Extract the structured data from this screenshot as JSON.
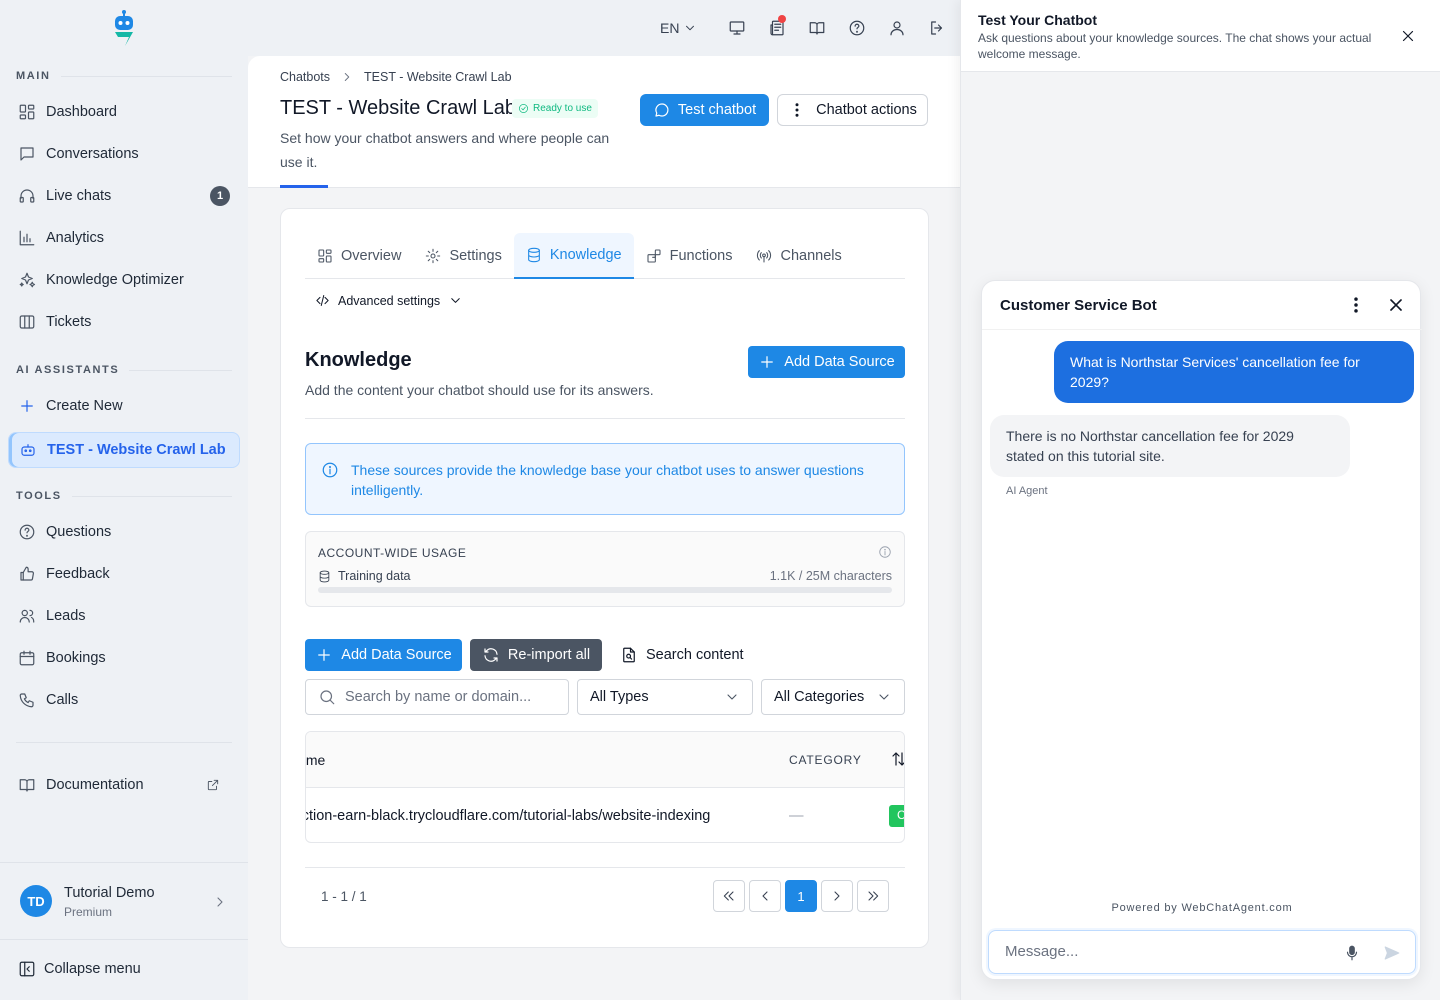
{
  "sidebar": {
    "sections": {
      "main": "MAIN",
      "ai": "AI ASSISTANTS",
      "tools": "TOOLS"
    },
    "main_items": [
      {
        "label": "Dashboard",
        "icon": "dashboard-icon"
      },
      {
        "label": "Conversations",
        "icon": "chat-icon"
      },
      {
        "label": "Live chats",
        "icon": "headset-icon",
        "badge": "1"
      },
      {
        "label": "Analytics",
        "icon": "analytics-icon"
      },
      {
        "label": "Knowledge Optimizer",
        "icon": "sparkles-icon"
      },
      {
        "label": "Tickets",
        "icon": "tickets-icon"
      }
    ],
    "ai_items": [
      {
        "label": "Create New",
        "icon": "plus-icon"
      },
      {
        "label": "TEST - Website Crawl Lab",
        "icon": "bot-icon",
        "active": true
      }
    ],
    "tool_items": [
      {
        "label": "Questions",
        "icon": "question-icon"
      },
      {
        "label": "Feedback",
        "icon": "thumbs-up-icon"
      },
      {
        "label": "Leads",
        "icon": "users-icon"
      },
      {
        "label": "Bookings",
        "icon": "calendar-icon"
      },
      {
        "label": "Calls",
        "icon": "phone-icon"
      }
    ],
    "documentation": "Documentation",
    "user": {
      "initials": "TD",
      "name": "Tutorial Demo",
      "plan": "Premium"
    },
    "collapse": "Collapse menu"
  },
  "topbar": {
    "lang": "EN"
  },
  "header": {
    "breadcrumb": [
      "Chatbots",
      "TEST - Website Crawl Lab"
    ],
    "title": "TEST - Website Crawl Lab",
    "status": "Ready to use",
    "description": "Set how your chatbot answers and where people can use it.",
    "test_button": "Test chatbot",
    "actions_button": "Chatbot actions"
  },
  "tabs": [
    {
      "label": "Overview",
      "icon": "overview-icon"
    },
    {
      "label": "Settings",
      "icon": "gear-icon"
    },
    {
      "label": "Knowledge",
      "icon": "database-icon",
      "active": true
    },
    {
      "label": "Functions",
      "icon": "functions-icon"
    },
    {
      "label": "Channels",
      "icon": "broadcast-icon"
    }
  ],
  "advanced_settings": "Advanced settings",
  "knowledge": {
    "title": "Knowledge",
    "description": "Add the content your chatbot should use for its answers.",
    "add_button": "Add Data Source",
    "info": "These sources provide the knowledge base your chatbot uses to answer questions intelligently.",
    "usage": {
      "title": "ACCOUNT-WIDE USAGE",
      "label": "Training data",
      "value": "1.1K / 25M characters",
      "fraction": 4.4e-05
    },
    "toolbar": {
      "add": "Add Data Source",
      "reimport": "Re-import all",
      "search_content": "Search content"
    },
    "search_placeholder": "Search by name or domain...",
    "type_filter": "All Types",
    "category_filter": "All Categories",
    "table": {
      "headers": {
        "name": "Name",
        "category": "CATEGORY"
      },
      "rows": [
        {
          "name": "https://reflection-earn-black.trycloudflare.com/tutorial-labs/website-indexing",
          "category": "—",
          "status": "Completed"
        }
      ]
    },
    "pagination": {
      "info": "1 - 1 / 1",
      "current": "1"
    }
  },
  "test_panel": {
    "title": "Test Your Chatbot",
    "subtitle": "Ask questions about your knowledge sources. The chat shows your actual welcome message.",
    "chat": {
      "title": "Customer Service Bot",
      "user_message": "What is Northstar Services' cancellation fee for 2029?",
      "bot_message": "There is no Northstar cancellation fee for 2029 stated on this tutorial site.",
      "bot_label": "AI Agent",
      "powered_by": "Powered by WebChatAgent.com",
      "input_placeholder": "Message..."
    }
  },
  "colors": {
    "accent": "#1e88e5",
    "success": "#22c55e",
    "user_bubble": "#1d6fe0"
  }
}
